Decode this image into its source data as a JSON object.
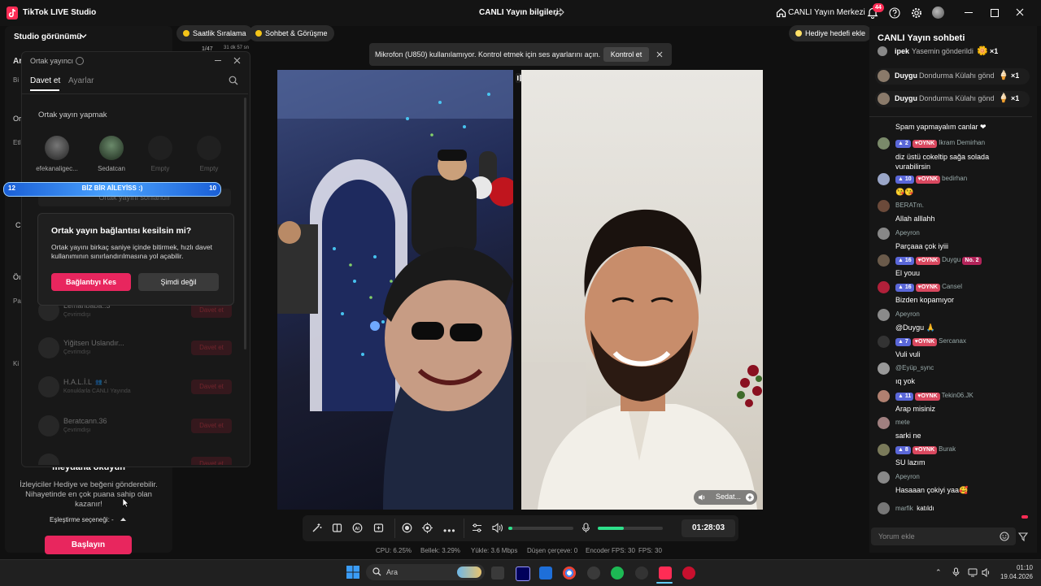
{
  "titlebar": {
    "app_name": "TikTok LIVE Studio",
    "center_title": "CANLI Yayın bilgileri",
    "live_center": "CANLI Yayın Merkezi",
    "notification_count": "44"
  },
  "sidebar": {
    "studio_view": "Studio görünümü",
    "cut_letters": [
      "Ar",
      "Bi",
      "Or",
      "Etl",
      "C",
      "Öı",
      "Pa",
      "Ki"
    ],
    "prompt_title": "meydana okuyun",
    "prompt_text": "İzleyiciler Hediye ve beğeni gönderebilir. Nihayetinde en çok puana sahip olan kazanır!",
    "match_option": "Eşleştirme seçeneği: -",
    "start_button": "Başlayın"
  },
  "top_pills": {
    "hourly_ranking": "Saatlik Sıralama",
    "chat_talk": "Sohbet & Görüşme",
    "gift_goal": "Hediye hedefi ekle",
    "counter": "1/47",
    "small_time": "31 dk 57 sn"
  },
  "cohost": {
    "title": "Ortak yayıncı",
    "tabs": [
      "Davet et",
      "Ayarlar"
    ],
    "section": "Ortak yayın yapmak",
    "guests": [
      {
        "name": "efekanaligec..."
      },
      {
        "name": "Sedatcan"
      },
      {
        "name": "Empty"
      },
      {
        "name": "Empty"
      }
    ],
    "end_button": "Ortak yayını sonlandır",
    "list": [
      {
        "name": "Lemanbaba..3",
        "status": "Çevrimdışı",
        "invite": "Davet et"
      },
      {
        "name": "Yiğitsen Uslandır...",
        "status": "Çevrimdışı",
        "invite": "Davet et"
      },
      {
        "name": "H.A.L.İ.L",
        "extra": "4",
        "status": "Konuklarla CANLI Yayında",
        "invite": "Davet et"
      },
      {
        "name": "Beratcann.36",
        "status": "Çevrimdışı",
        "invite": "Davet et"
      },
      {
        "name": "",
        "status": "",
        "invite": "Davet et"
      }
    ]
  },
  "banner": {
    "left_number": "12",
    "text": "BİZ BİR AİLEYİSS :)",
    "right_number": "10"
  },
  "confirm_dialog": {
    "title": "Ortak yayın bağlantısı kesilsin mi?",
    "body": "Ortak yayını birkaç saniye içinde bitirmek, hızlı davet kullanımının sınırlandırılmasına yol açabilir.",
    "primary": "Bağlantıyı Kes",
    "secondary": "Şimdi değil"
  },
  "toast": {
    "message": "Mikrofon (U850) kullanılamıyor. Kontrol etmek için ses ayarlarını açın.",
    "action": "Kontrol et"
  },
  "video": {
    "right_guest_label": "Sedat..."
  },
  "controls": {
    "volume_level": 0.06,
    "mic_level": 0.4,
    "timer": "01:28:03"
  },
  "stats": {
    "cpu": "CPU: 6.25%",
    "memory": "Bellek: 3.29%",
    "upload": "Yükle: 3.6 Mbps",
    "dropped": "Düşen çerçeve: 0",
    "encoder_fps": "Encoder FPS: 30",
    "fps": "FPS: 30"
  },
  "chat": {
    "title": "CANLI Yayın sohbeti",
    "gifts": [
      {
        "user": "ipek",
        "text": "Yasemin gönderildi",
        "count": "×1"
      },
      {
        "user": "Duygu",
        "text": "Dondurma Külahı gönd",
        "count": "×1"
      },
      {
        "user": "Duygu",
        "text": "Dondurma Külahı gönd",
        "count": "×1"
      }
    ],
    "messages": [
      {
        "user": "",
        "lvl": "",
        "fan": "",
        "text": "Spam yapmayalım canlar ❤"
      },
      {
        "user": "Ikram Demirhan",
        "lvl": "2",
        "fan": "OYNK",
        "text": "diz üstü cokeltip sağa solada vurabilirsin"
      },
      {
        "user": "bedirhan",
        "lvl": "10",
        "fan": "OYNK",
        "text": "😘😘"
      },
      {
        "user": "BERATm.",
        "lvl": "",
        "fan": "",
        "text": "Allah alllahh"
      },
      {
        "user": "Apeyron",
        "lvl": "",
        "fan": "",
        "text": "Parçaaa çok iyiii"
      },
      {
        "user": "Duygu",
        "lvl": "16",
        "fan": "OYNK",
        "no": "No. 2",
        "text": "El youu"
      },
      {
        "user": "Cansel",
        "lvl": "16",
        "fan": "OYNK",
        "text": "Bizden kopamıyor"
      },
      {
        "user": "Apeyron",
        "lvl": "",
        "fan": "",
        "text": "@Duygu 🙏"
      },
      {
        "user": "Sercanax",
        "lvl": "7",
        "fan": "OYNK",
        "text": "Vuli vuli"
      },
      {
        "user": "@Eyüp_sync",
        "lvl": "",
        "fan": "",
        "text": "ıq yok"
      },
      {
        "user": "Tekin06.JK",
        "lvl": "11",
        "fan": "OYNK",
        "text": "Arap misiniz"
      },
      {
        "user": "mete",
        "lvl": "",
        "fan": "",
        "text": "sarki ne"
      },
      {
        "user": "Burak",
        "lvl": "8",
        "fan": "OYNK",
        "text": "SU lazım"
      },
      {
        "user": "Apeyron",
        "lvl": "",
        "fan": "",
        "text": "Hasaaan çokiyi yaa🥰"
      }
    ],
    "join": {
      "user": "marfik",
      "text": "katıldı"
    },
    "comment_placeholder": "Yorum ekle"
  },
  "taskbar": {
    "search": "Ara",
    "time": "01:10",
    "date": "19.04.2026"
  }
}
